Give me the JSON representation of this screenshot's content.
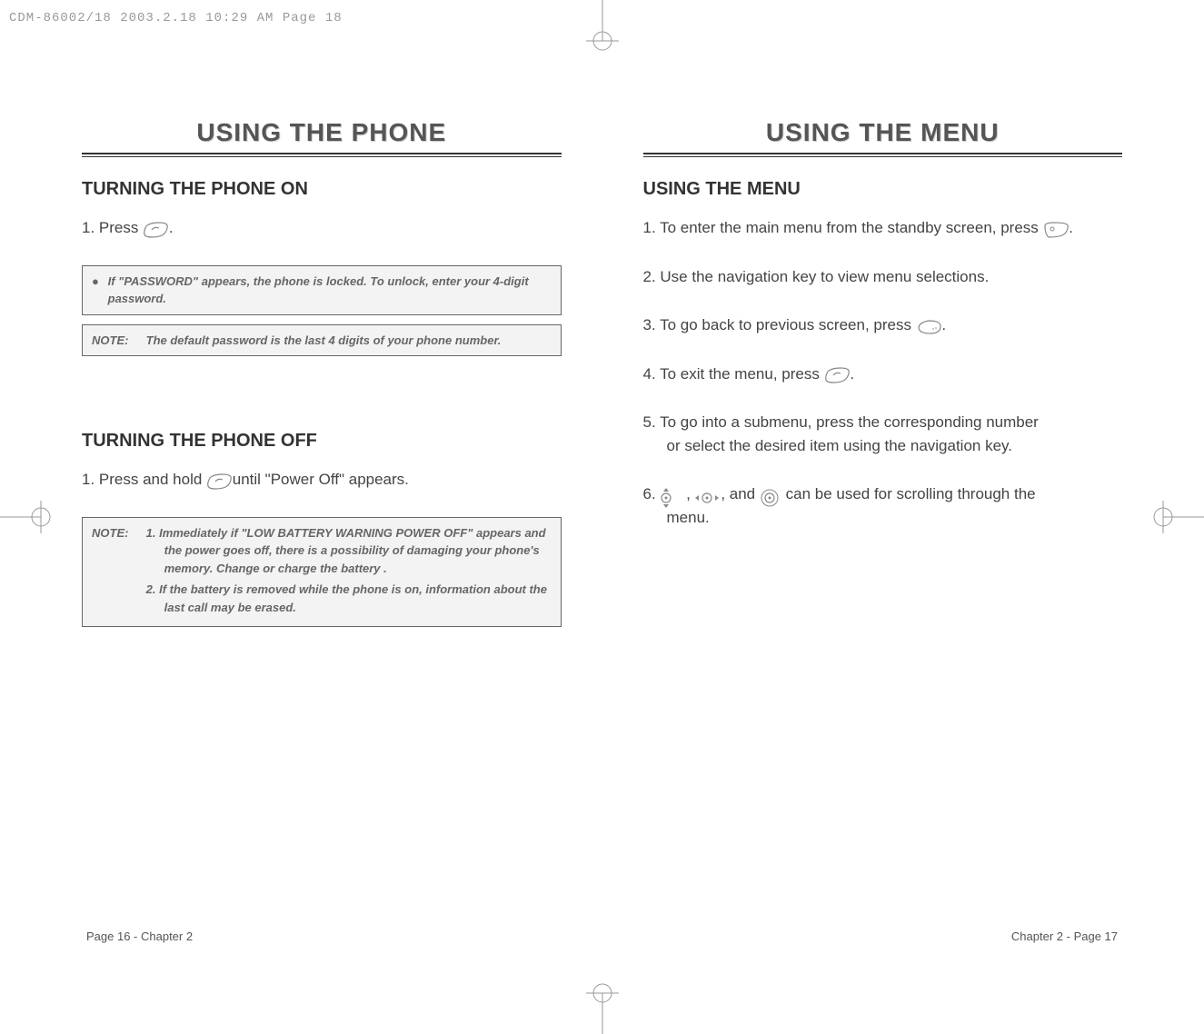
{
  "header_line": "CDM-86002/18  2003.2.18  10:29 AM  Page 18",
  "left_page": {
    "title": "USING THE PHONE",
    "section1_title": "TURNING THE PHONE ON",
    "step1_prefix": "1. Press ",
    "step1_suffix": " .",
    "note_box1_bullet": "●",
    "note_box1_text": "If \"PASSWORD\" appears, the phone is locked. To unlock, enter your 4-digit password.",
    "note_box2_label": "NOTE:",
    "note_box2_text": "The default password is the last 4 digits of your phone number.",
    "section2_title": "TURNING THE PHONE OFF",
    "step2_prefix": "1. Press and hold ",
    "step2_suffix": " until \"Power Off\" appears.",
    "note_box3_label": "NOTE:",
    "note_box3_item1": "1. Immediately if \"LOW BATTERY WARNING POWER OFF\" appears and the power goes off, there is a possibility of damaging your phone's memory. Change or charge the battery .",
    "note_box3_item2": "2. If the battery is removed while the phone is on, information about the last call may be erased."
  },
  "right_page": {
    "title": "USING THE MENU",
    "section_title": "USING THE MENU",
    "step1_prefix": "1. To enter the main menu from the standby screen, press ",
    "step1_suffix": " .",
    "step2": "2. Use the navigation key to view menu selections.",
    "step3_prefix": "3. To go back to previous screen, press ",
    "step3_suffix": " .",
    "step4_prefix": "4. To exit the menu, press ",
    "step4_suffix": " .",
    "step5": "5. To go into a submenu, press the corresponding number",
    "step5_indent": "or select the desired item using the navigation key.",
    "step6_prefix": "6. ",
    "step6_comma1": " , ",
    "step6_comma2": ", and ",
    "step6_suffix": " can be used for scrolling through the",
    "step6_indent": "menu."
  },
  "footer_left": "Page 16 - Chapter 2",
  "footer_right": "Chapter 2 - Page 17"
}
